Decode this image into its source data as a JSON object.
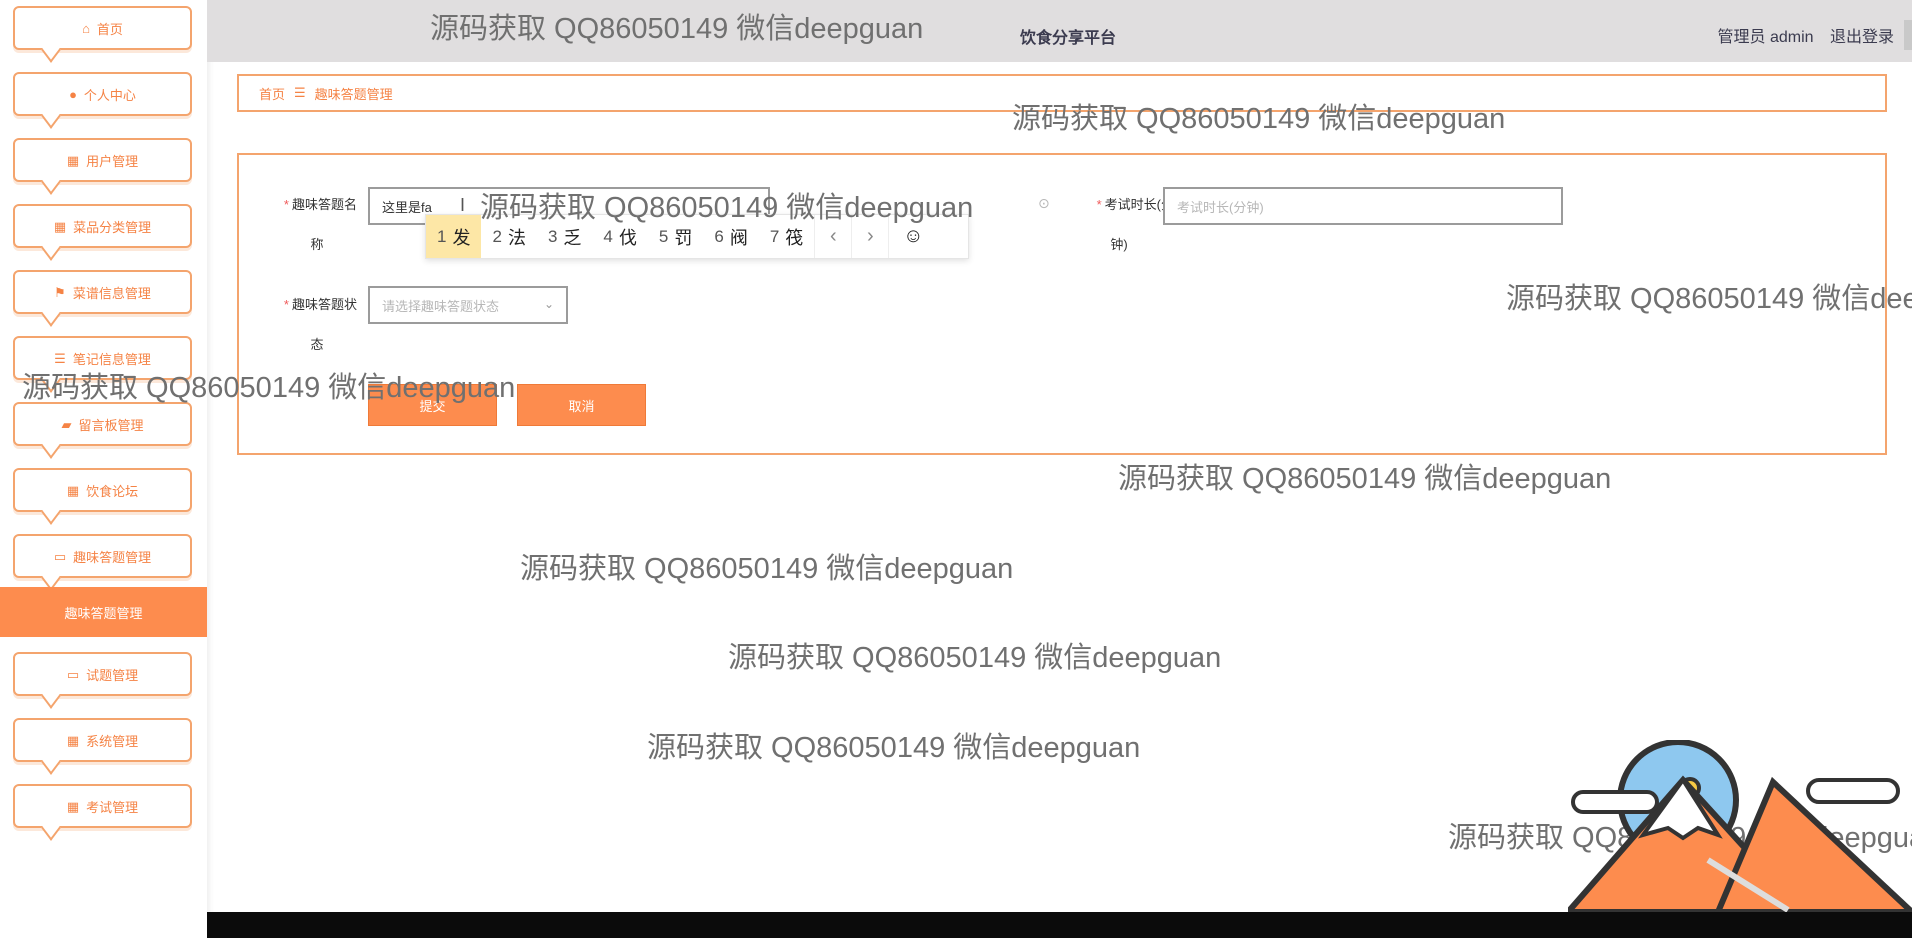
{
  "header": {
    "title": "饮食分享平台",
    "user_label": "管理员 admin",
    "logout": "退出登录"
  },
  "sidebar": {
    "items": [
      {
        "label": "首页",
        "icon": "home-icon"
      },
      {
        "label": "个人中心",
        "icon": "user-icon"
      },
      {
        "label": "用户管理",
        "icon": "grid-icon"
      },
      {
        "label": "菜品分类管理",
        "icon": "grid-icon"
      },
      {
        "label": "菜谱信息管理",
        "icon": "flag-icon"
      },
      {
        "label": "笔记信息管理",
        "icon": "sliders-icon"
      },
      {
        "label": "留言板管理",
        "icon": "thumb-icon"
      },
      {
        "label": "饮食论坛",
        "icon": "grid-icon"
      },
      {
        "label": "趣味答题管理",
        "icon": "monitor-icon"
      },
      {
        "label": "试题管理",
        "icon": "monitor-icon"
      },
      {
        "label": "系统管理",
        "icon": "grid-icon"
      },
      {
        "label": "考试管理",
        "icon": "grid-icon"
      }
    ],
    "active_sub": "趣味答题管理"
  },
  "breadcrumb": {
    "home": "首页",
    "sep": "☰",
    "current": "趣味答题管理"
  },
  "form": {
    "name_label_1": "趣味答题名",
    "name_label_2": "称",
    "name_value": "这里是fa",
    "duration_label_1": "考试时长(分",
    "duration_label_2": "钟)",
    "duration_placeholder": "考试时长(分钟)",
    "status_label_1": "趣味答题状",
    "status_label_2": "态",
    "status_placeholder": "请选择趣味答题状态",
    "submit": "提交",
    "cancel": "取消"
  },
  "ime": {
    "candidates": [
      {
        "num": "1",
        "text": "发"
      },
      {
        "num": "2",
        "text": "法"
      },
      {
        "num": "3",
        "text": "乏"
      },
      {
        "num": "4",
        "text": "伐"
      },
      {
        "num": "5",
        "text": "罚"
      },
      {
        "num": "6",
        "text": "阀"
      },
      {
        "num": "7",
        "text": "筏"
      }
    ],
    "prev": "‹",
    "next": "›",
    "emoji": "☺"
  },
  "watermark": "源码获取 QQ86050149 微信deepguan"
}
